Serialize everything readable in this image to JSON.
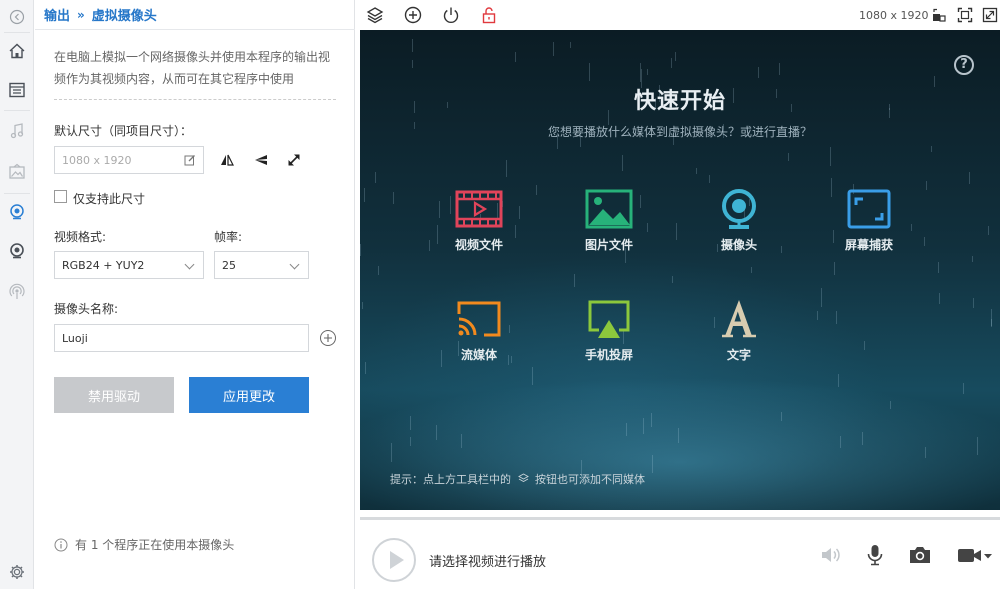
{
  "panel": {
    "breadcrumb": {
      "parent": "输出",
      "separator": "»",
      "current": "虚拟摄像头"
    },
    "description": "在电脑上模拟一个网络摄像头并使用本程序的输出视频作为其视频内容，从而可在其它程序中使用",
    "size_label": "默认尺寸（同项目尺寸）：",
    "size_placeholder": "1080 x 1920",
    "only_support_label": "仅支持此尺寸",
    "video_format_label": "视频格式:",
    "video_format_value": "RGB24 + YUY2",
    "framerate_label": "帧率:",
    "framerate_value": "25",
    "camera_name_label": "摄像头名称:",
    "camera_name_value": "Luoji",
    "disable_driver_label": "禁用驱动",
    "apply_label": "应用更改",
    "usage_info": "有 1 个程序正在使用本摄像头"
  },
  "toolbar": {
    "resolution": "1080 x 1920"
  },
  "stage": {
    "title": "快速开始",
    "subtitle": "您想要播放什么媒体到虚拟摄像头？或进行直播？",
    "items": [
      {
        "label": "视频文件",
        "color": "#e0445a"
      },
      {
        "label": "图片文件",
        "color": "#27b27a"
      },
      {
        "label": "摄像头",
        "color": "#3fb4d4"
      },
      {
        "label": "屏幕捕获",
        "color": "#3a9ee8"
      },
      {
        "label": "流媒体",
        "color": "#f28a1e"
      },
      {
        "label": "手机投屏",
        "color": "#8cc83c"
      },
      {
        "label": "文字",
        "color": "#d8ccb0"
      }
    ],
    "hint_prefix": "提示：点上方工具栏中的",
    "hint_suffix": "按钮也可添加不同媒体"
  },
  "player": {
    "status": "请选择视频进行播放"
  }
}
